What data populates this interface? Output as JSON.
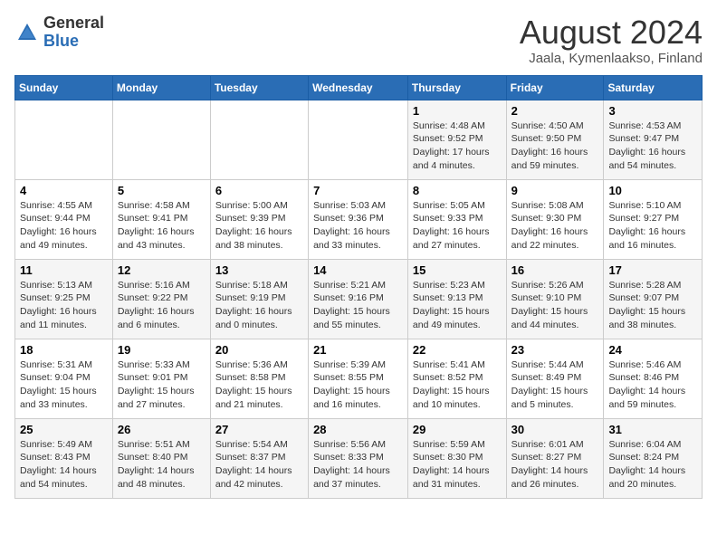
{
  "header": {
    "logo_general": "General",
    "logo_blue": "Blue",
    "title": "August 2024",
    "subtitle": "Jaala, Kymenlaakso, Finland"
  },
  "weekdays": [
    "Sunday",
    "Monday",
    "Tuesday",
    "Wednesday",
    "Thursday",
    "Friday",
    "Saturday"
  ],
  "weeks": [
    [
      {
        "day": "",
        "detail": ""
      },
      {
        "day": "",
        "detail": ""
      },
      {
        "day": "",
        "detail": ""
      },
      {
        "day": "",
        "detail": ""
      },
      {
        "day": "1",
        "detail": "Sunrise: 4:48 AM\nSunset: 9:52 PM\nDaylight: 17 hours\nand 4 minutes."
      },
      {
        "day": "2",
        "detail": "Sunrise: 4:50 AM\nSunset: 9:50 PM\nDaylight: 16 hours\nand 59 minutes."
      },
      {
        "day": "3",
        "detail": "Sunrise: 4:53 AM\nSunset: 9:47 PM\nDaylight: 16 hours\nand 54 minutes."
      }
    ],
    [
      {
        "day": "4",
        "detail": "Sunrise: 4:55 AM\nSunset: 9:44 PM\nDaylight: 16 hours\nand 49 minutes."
      },
      {
        "day": "5",
        "detail": "Sunrise: 4:58 AM\nSunset: 9:41 PM\nDaylight: 16 hours\nand 43 minutes."
      },
      {
        "day": "6",
        "detail": "Sunrise: 5:00 AM\nSunset: 9:39 PM\nDaylight: 16 hours\nand 38 minutes."
      },
      {
        "day": "7",
        "detail": "Sunrise: 5:03 AM\nSunset: 9:36 PM\nDaylight: 16 hours\nand 33 minutes."
      },
      {
        "day": "8",
        "detail": "Sunrise: 5:05 AM\nSunset: 9:33 PM\nDaylight: 16 hours\nand 27 minutes."
      },
      {
        "day": "9",
        "detail": "Sunrise: 5:08 AM\nSunset: 9:30 PM\nDaylight: 16 hours\nand 22 minutes."
      },
      {
        "day": "10",
        "detail": "Sunrise: 5:10 AM\nSunset: 9:27 PM\nDaylight: 16 hours\nand 16 minutes."
      }
    ],
    [
      {
        "day": "11",
        "detail": "Sunrise: 5:13 AM\nSunset: 9:25 PM\nDaylight: 16 hours\nand 11 minutes."
      },
      {
        "day": "12",
        "detail": "Sunrise: 5:16 AM\nSunset: 9:22 PM\nDaylight: 16 hours\nand 6 minutes."
      },
      {
        "day": "13",
        "detail": "Sunrise: 5:18 AM\nSunset: 9:19 PM\nDaylight: 16 hours\nand 0 minutes."
      },
      {
        "day": "14",
        "detail": "Sunrise: 5:21 AM\nSunset: 9:16 PM\nDaylight: 15 hours\nand 55 minutes."
      },
      {
        "day": "15",
        "detail": "Sunrise: 5:23 AM\nSunset: 9:13 PM\nDaylight: 15 hours\nand 49 minutes."
      },
      {
        "day": "16",
        "detail": "Sunrise: 5:26 AM\nSunset: 9:10 PM\nDaylight: 15 hours\nand 44 minutes."
      },
      {
        "day": "17",
        "detail": "Sunrise: 5:28 AM\nSunset: 9:07 PM\nDaylight: 15 hours\nand 38 minutes."
      }
    ],
    [
      {
        "day": "18",
        "detail": "Sunrise: 5:31 AM\nSunset: 9:04 PM\nDaylight: 15 hours\nand 33 minutes."
      },
      {
        "day": "19",
        "detail": "Sunrise: 5:33 AM\nSunset: 9:01 PM\nDaylight: 15 hours\nand 27 minutes."
      },
      {
        "day": "20",
        "detail": "Sunrise: 5:36 AM\nSunset: 8:58 PM\nDaylight: 15 hours\nand 21 minutes."
      },
      {
        "day": "21",
        "detail": "Sunrise: 5:39 AM\nSunset: 8:55 PM\nDaylight: 15 hours\nand 16 minutes."
      },
      {
        "day": "22",
        "detail": "Sunrise: 5:41 AM\nSunset: 8:52 PM\nDaylight: 15 hours\nand 10 minutes."
      },
      {
        "day": "23",
        "detail": "Sunrise: 5:44 AM\nSunset: 8:49 PM\nDaylight: 15 hours\nand 5 minutes."
      },
      {
        "day": "24",
        "detail": "Sunrise: 5:46 AM\nSunset: 8:46 PM\nDaylight: 14 hours\nand 59 minutes."
      }
    ],
    [
      {
        "day": "25",
        "detail": "Sunrise: 5:49 AM\nSunset: 8:43 PM\nDaylight: 14 hours\nand 54 minutes."
      },
      {
        "day": "26",
        "detail": "Sunrise: 5:51 AM\nSunset: 8:40 PM\nDaylight: 14 hours\nand 48 minutes."
      },
      {
        "day": "27",
        "detail": "Sunrise: 5:54 AM\nSunset: 8:37 PM\nDaylight: 14 hours\nand 42 minutes."
      },
      {
        "day": "28",
        "detail": "Sunrise: 5:56 AM\nSunset: 8:33 PM\nDaylight: 14 hours\nand 37 minutes."
      },
      {
        "day": "29",
        "detail": "Sunrise: 5:59 AM\nSunset: 8:30 PM\nDaylight: 14 hours\nand 31 minutes."
      },
      {
        "day": "30",
        "detail": "Sunrise: 6:01 AM\nSunset: 8:27 PM\nDaylight: 14 hours\nand 26 minutes."
      },
      {
        "day": "31",
        "detail": "Sunrise: 6:04 AM\nSunset: 8:24 PM\nDaylight: 14 hours\nand 20 minutes."
      }
    ]
  ]
}
